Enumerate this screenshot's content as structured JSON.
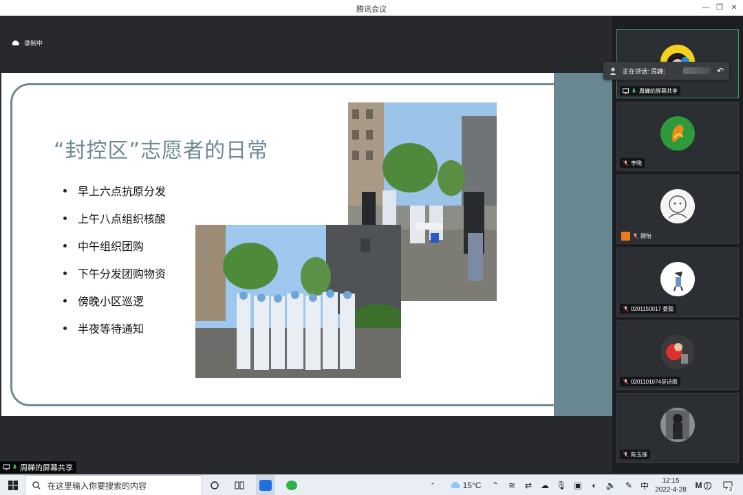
{
  "window": {
    "title": "腾讯会议"
  },
  "status": {
    "recording": "录制中"
  },
  "slide": {
    "title": "“封控区”志愿者的日常",
    "bullets": [
      "早上六点抗原分发",
      "上午八点组织核酸",
      "中午组织团购",
      "下午分发团购物资",
      "傍晚小区巡逻",
      "半夜等待通知"
    ]
  },
  "speaking": {
    "text": "正在讲话: 周韡;"
  },
  "participants": [
    {
      "label": "周韡的屏幕共享",
      "active": true
    },
    {
      "label": "李晓"
    },
    {
      "label": "顾怡"
    },
    {
      "label": "0201150017 娄懿"
    },
    {
      "label": "0201101074昰诗雨"
    },
    {
      "label": "陈玉琢"
    }
  ],
  "share_label": "周韡的屏幕共享",
  "taskbar": {
    "search_placeholder": "在这里输入你要搜索的内容",
    "weather": "15°C",
    "ime": "中",
    "time": "12:15",
    "date": "2022-4-28",
    "notification_count": "3",
    "badge": "1"
  },
  "colors": {
    "accent": "#6d8994",
    "active_border": "#3e9a61",
    "mic_green": "#3fbf5f"
  }
}
